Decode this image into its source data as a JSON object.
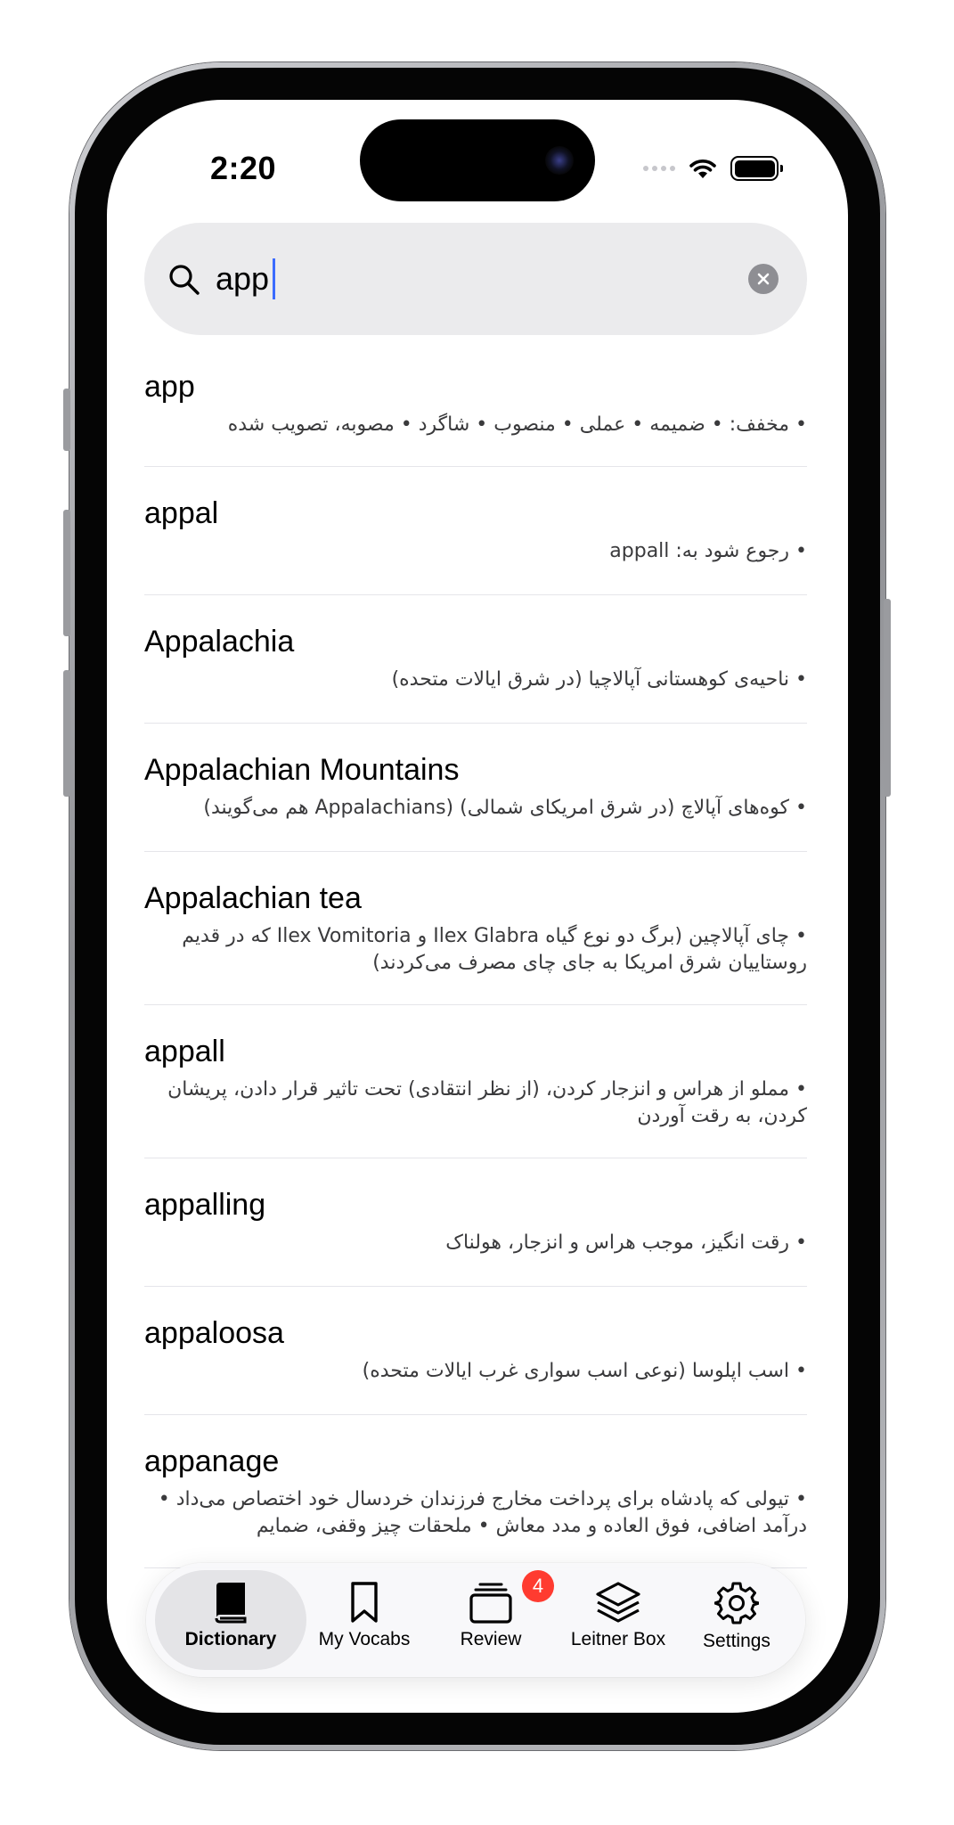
{
  "status_bar": {
    "time": "2:20"
  },
  "search": {
    "value": "app",
    "placeholder": ""
  },
  "results": [
    {
      "word": "app",
      "definition": "• مخفف: • ضمیمه • عملی • منصوب • شاگرد • مصوبه، تصویب شده"
    },
    {
      "word": "appal",
      "definition": "• رجوع شود به: appall"
    },
    {
      "word": "Appalachia",
      "definition": "• ناحیه‌ی کوهستانی آپالاچیا (در شرق ایالات متحده)"
    },
    {
      "word": "Appalachian Mountains",
      "definition": "• کوه‌های آپالاچ (در شرق امریکای شمالی) (Appalachians هم می‌گویند)"
    },
    {
      "word": "Appalachian tea",
      "definition": "• چای آپالاچین (برگ دو نوع گیاه Ilex Glabra و Ilex Vomitoria که در قدیم روستاییان شرق امریکا به جای چای مصرف می‌کردند)"
    },
    {
      "word": "appall",
      "definition": "• مملو از هراس و انزجار کردن، (از نظر انتقادی) تحت تاثیر قرار دادن، پریشان کردن، به رقت آوردن"
    },
    {
      "word": "appalling",
      "definition": "• رقت انگیز، موجب هراس و انزجار، هولناک"
    },
    {
      "word": "appaloosa",
      "definition": "• اسب اپلوسا (نوعی اسب سواری غرب ایالات متحده)"
    },
    {
      "word": "appanage",
      "definition": "• تیولی که پادشاه برای پرداخت مخارج فرزندان خردسال خود اختصاص می‌داد • درآمد اضافی، فوق العاده و مدد معاش • ملحقات چیز وقفی، ضمایم"
    }
  ],
  "tab_bar": {
    "dictionary": "Dictionary",
    "my_vocabs": "My Vocabs",
    "review": "Review",
    "review_badge": "4",
    "leitner_box": "Leitner Box",
    "settings": "Settings"
  },
  "colors": {
    "accent": "#3b6bff",
    "badge": "#ff3b30",
    "search_bg": "#ebebed"
  }
}
